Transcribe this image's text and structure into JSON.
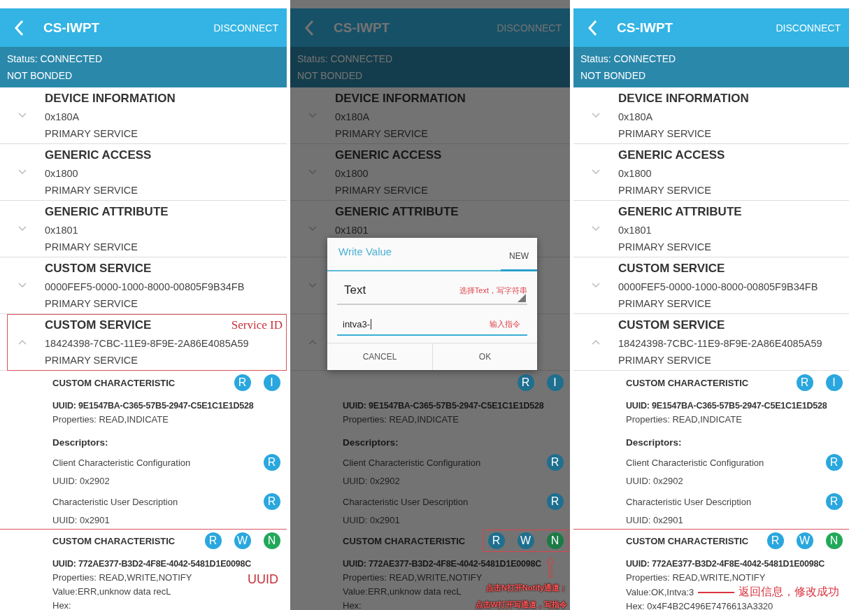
{
  "panels": [
    {
      "dimmed": false,
      "header": {
        "title": "CS-IWPT",
        "action": "DISCONNECT"
      },
      "status": "Status: CONNECTED",
      "bond": "NOT BONDED",
      "services": [
        {
          "name": "DEVICE INFORMATION",
          "uuid": "0x180A",
          "type": "PRIMARY SERVICE",
          "expanded": false,
          "outline": false
        },
        {
          "name": "GENERIC ACCESS",
          "uuid": "0x1800",
          "type": "PRIMARY SERVICE",
          "expanded": false,
          "outline": false
        },
        {
          "name": "GENERIC ATTRIBUTE",
          "uuid": "0x1801",
          "type": "PRIMARY SERVICE",
          "expanded": false,
          "outline": false
        },
        {
          "name": "CUSTOM SERVICE",
          "uuid": "0000FEF5-0000-1000-8000-00805F9B34FB",
          "type": "PRIMARY SERVICE",
          "expanded": false,
          "outline": false
        },
        {
          "name": "CUSTOM SERVICE",
          "uuid": "18424398-7CBC-11E9-8F9E-2A86E4085A59",
          "type": "PRIMARY SERVICE",
          "expanded": true,
          "outline": true,
          "outline_label": "Service ID"
        }
      ],
      "characteristics": [
        {
          "name": "CUSTOM CHARACTERISTIC",
          "badges": [
            {
              "letter": "R",
              "color": "#2aa7de"
            },
            {
              "letter": "I",
              "color": "#2aa7de"
            }
          ],
          "uuid": "UUID: 9E1547BA-C365-57B5-2947-C5E1C1E1D528",
          "properties": "Properties: READ,INDICATE",
          "outline": false,
          "badges_outline": false,
          "descriptors_label": "Descriptors:",
          "descriptors": [
            {
              "name": "Client Characteristic Configuration",
              "uuid": "UUID: 0x2902",
              "badges": [
                {
                  "letter": "R",
                  "color": "#2aa7de"
                }
              ]
            },
            {
              "name": "Characteristic User Description",
              "uuid": "UUID: 0x2901",
              "badges": [
                {
                  "letter": "R",
                  "color": "#2aa7de"
                }
              ]
            }
          ]
        },
        {
          "name": "CUSTOM CHARACTERISTIC",
          "badges": [
            {
              "letter": "R",
              "color": "#2aa7de"
            },
            {
              "letter": "W",
              "color": "#2aa7de"
            },
            {
              "letter": "N",
              "color": "#22a85a"
            }
          ],
          "uuid": "UUID: 772AE377-B3D2-4F8E-4042-5481D1E0098C",
          "properties": "Properties: READ,WRITE,NOTIFY",
          "outline": true,
          "outline_label": "UUID",
          "badges_outline": false,
          "value": "Value:ERR,unknow data recL",
          "hex": "Hex:"
        }
      ]
    },
    {
      "dimmed": true,
      "header": {
        "title": "CS-IWPT",
        "action": "DISCONNECT"
      },
      "status": "Status: CONNECTED",
      "bond": "NOT BONDED",
      "services": [
        {
          "name": "DEVICE INFORMATION",
          "uuid": "0x180A",
          "type": "PRIMARY SERVICE",
          "expanded": false,
          "outline": false
        },
        {
          "name": "GENERIC ACCESS",
          "uuid": "0x1800",
          "type": "PRIMARY SERVICE",
          "expanded": false,
          "outline": false
        },
        {
          "name": "GENERIC ATTRIBUTE",
          "uuid": "0x1801",
          "expanded": false,
          "outline": false
        },
        {
          "expanded": false,
          "outline": false
        },
        {
          "expanded": true,
          "outline": false
        }
      ],
      "characteristics": [
        {
          "badges": [
            {
              "letter": "R",
              "color": "#1f6f8f"
            },
            {
              "letter": "I",
              "color": "#1f6f8f"
            }
          ],
          "uuid": "UUID: 9E1547BA-C365-57B5-2947-C5E1C1E1D528",
          "properties": "Properties: READ,INDICATE",
          "outline": false,
          "badges_outline": false,
          "descriptors_label": "Descriptors:",
          "descriptors": [
            {
              "name": "Client Characteristic Configuration",
              "uuid": "UUID: 0x2902",
              "badges": [
                {
                  "letter": "R",
                  "color": "#1f6f8f"
                }
              ]
            },
            {
              "name": "Characteristic User Description",
              "uuid": "UUID: 0x2901",
              "badges": [
                {
                  "letter": "R",
                  "color": "#1f6f8f"
                }
              ]
            }
          ]
        },
        {
          "name": "CUSTOM CHARACTERISTIC",
          "badges": [
            {
              "letter": "R",
              "color": "#1f6f8f"
            },
            {
              "letter": "W",
              "color": "#1f6f8f"
            },
            {
              "letter": "N",
              "color": "#1c7a45"
            }
          ],
          "uuid": "UUID: 772AE377-B3D2-4F8E-4042-5481D1E0098C",
          "properties": "Properties: READ,WRITE,NOTIFY",
          "outline": false,
          "badges_outline": true,
          "badge_note": [
            "点击N打开Notify通道；",
            "点击W打开写通道，写指令"
          ],
          "value": "Value:ERR,unknow data recL",
          "hex": "Hex:"
        }
      ],
      "dialog": {
        "title": "Write Value",
        "tabs": [
          {
            "label": "NEW",
            "selected": true
          }
        ],
        "format": {
          "value": "Text",
          "note": "选择Text，写字符串"
        },
        "input": {
          "value": "intva3-",
          "note": "输入指令"
        },
        "buttons": [
          "CANCEL",
          "OK"
        ]
      }
    },
    {
      "dimmed": false,
      "header": {
        "title": "CS-IWPT",
        "action": "DISCONNECT"
      },
      "status": "Status: CONNECTED",
      "bond": "NOT BONDED",
      "services": [
        {
          "name": "DEVICE INFORMATION",
          "uuid": "0x180A",
          "type": "PRIMARY SERVICE",
          "expanded": false,
          "outline": false
        },
        {
          "name": "GENERIC ACCESS",
          "uuid": "0x1800",
          "type": "PRIMARY SERVICE",
          "expanded": false,
          "outline": false
        },
        {
          "name": "GENERIC ATTRIBUTE",
          "uuid": "0x1801",
          "type": "PRIMARY SERVICE",
          "expanded": false,
          "outline": false
        },
        {
          "name": "CUSTOM SERVICE",
          "uuid": "0000FEF5-0000-1000-8000-00805F9B34FB",
          "type": "PRIMARY SERVICE",
          "expanded": false,
          "outline": false
        },
        {
          "name": "CUSTOM SERVICE",
          "uuid": "18424398-7CBC-11E9-8F9E-2A86E4085A59",
          "type": "PRIMARY SERVICE",
          "expanded": true,
          "outline": false
        }
      ],
      "characteristics": [
        {
          "name": "CUSTOM CHARACTERISTIC",
          "badges": [
            {
              "letter": "R",
              "color": "#2aa7de"
            },
            {
              "letter": "I",
              "color": "#2aa7de"
            }
          ],
          "uuid": "UUID: 9E1547BA-C365-57B5-2947-C5E1C1E1D528",
          "properties": "Properties: READ,INDICATE",
          "outline": false,
          "badges_outline": false,
          "descriptors_label": "Descriptors:",
          "descriptors": [
            {
              "name": "Client Characteristic Configuration",
              "uuid": "UUID: 0x2902",
              "badges": [
                {
                  "letter": "R",
                  "color": "#2aa7de"
                }
              ]
            },
            {
              "name": "Characteristic User Description",
              "uuid": "UUID: 0x2901",
              "badges": [
                {
                  "letter": "R",
                  "color": "#2aa7de"
                }
              ]
            }
          ]
        },
        {
          "name": "CUSTOM CHARACTERISTIC",
          "badges": [
            {
              "letter": "R",
              "color": "#2aa7de"
            },
            {
              "letter": "W",
              "color": "#2aa7de"
            },
            {
              "letter": "N",
              "color": "#22a85a"
            }
          ],
          "uuid": "UUID: 772AE377-B3D2-4F8E-4042-5481D1E0098C",
          "properties": "Properties: READ,WRITE,NOTIFY",
          "outline": true,
          "badges_outline": false,
          "value": "Value:OK,Intva:3",
          "value_note": "返回信息，修改成功",
          "hex": "Hex: 0x4F4B2C496E7476613A3320"
        }
      ]
    }
  ]
}
